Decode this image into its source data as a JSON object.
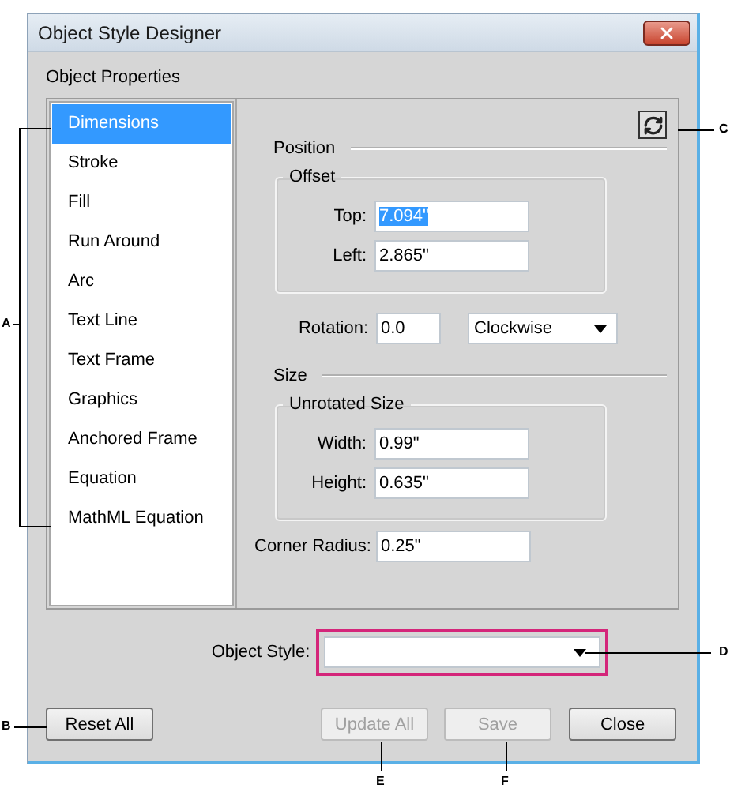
{
  "window": {
    "title": "Object Style Designer"
  },
  "section_label": "Object Properties",
  "categories": [
    {
      "label": "Dimensions",
      "selected": true
    },
    {
      "label": "Stroke",
      "selected": false
    },
    {
      "label": "Fill",
      "selected": false
    },
    {
      "label": "Run Around",
      "selected": false
    },
    {
      "label": "Arc",
      "selected": false
    },
    {
      "label": "Text Line",
      "selected": false
    },
    {
      "label": "Text Frame",
      "selected": false
    },
    {
      "label": "Graphics",
      "selected": false
    },
    {
      "label": "Anchored Frame",
      "selected": false
    },
    {
      "label": "Equation",
      "selected": false
    },
    {
      "label": "MathML Equation",
      "selected": false
    }
  ],
  "position": {
    "heading": "Position",
    "offset": {
      "heading": "Offset",
      "fields": [
        {
          "label": "Top:",
          "value": "7.094\"",
          "text_selected": true
        },
        {
          "label": "Left:",
          "value": "2.865\"",
          "text_selected": false
        }
      ]
    },
    "rotation": {
      "label": "Rotation:",
      "value": "0.0",
      "direction": "Clockwise"
    }
  },
  "size": {
    "heading": "Size",
    "unrotated": {
      "heading": "Unrotated Size",
      "fields": [
        {
          "label": "Width:",
          "value": "0.99\"",
          "text_selected": false
        },
        {
          "label": "Height:",
          "value": "0.635\"",
          "text_selected": false
        }
      ]
    },
    "corner_radius": {
      "label": "Corner Radius:",
      "value": "0.25\""
    }
  },
  "object_style": {
    "label": "Object Style:",
    "highlighted": true
  },
  "buttons": [
    {
      "label": "Reset All",
      "disabled": false
    },
    {
      "label": "Update All",
      "disabled": true
    },
    {
      "label": "Save",
      "disabled": true
    },
    {
      "label": "Close",
      "disabled": false
    }
  ],
  "callouts": [
    "A",
    "B",
    "C",
    "D",
    "E",
    "F"
  ]
}
